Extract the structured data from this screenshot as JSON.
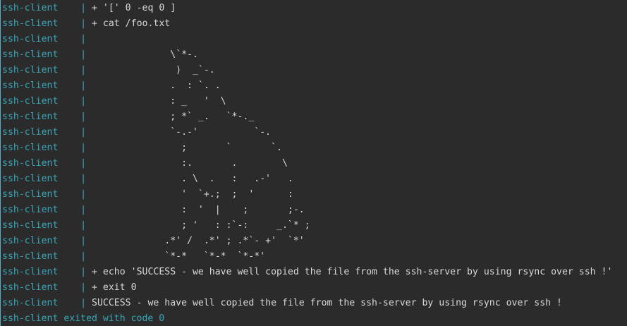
{
  "terminal": {
    "prefix": "ssh-client    ",
    "separator": "| ",
    "lines": [
      "+ '[' 0 -eq 0 ]",
      "+ cat /foo.txt",
      "",
      "              \\`*-.",
      "               )  _`-.",
      "              .  : `. .",
      "              : _   '  \\",
      "              ; *` _.   `*-._",
      "              `-.-'          `-.",
      "                ;       `       `.",
      "                :.       .        \\",
      "                . \\  .   :   .-'   .",
      "                '  `+.;  ;  '      :",
      "                :  '  |    ;       ;-.",
      "                ; '   : :`-:     _.`* ;",
      "             .*' /  .*' ; .*`- +'  `*'",
      "             `*-*   `*-*  `*-*'",
      "+ echo 'SUCCESS - we have well copied the file from the ssh-server by using rsync over ssh !'",
      "+ exit 0",
      "SUCCESS - we have well copied the file from the ssh-server by using rsync over ssh !"
    ],
    "exit_message": "ssh-client exited with code 0"
  },
  "colors": {
    "background": "#2b2b2b",
    "prefix": "#3aa6b9",
    "text": "#d8d8d8"
  }
}
